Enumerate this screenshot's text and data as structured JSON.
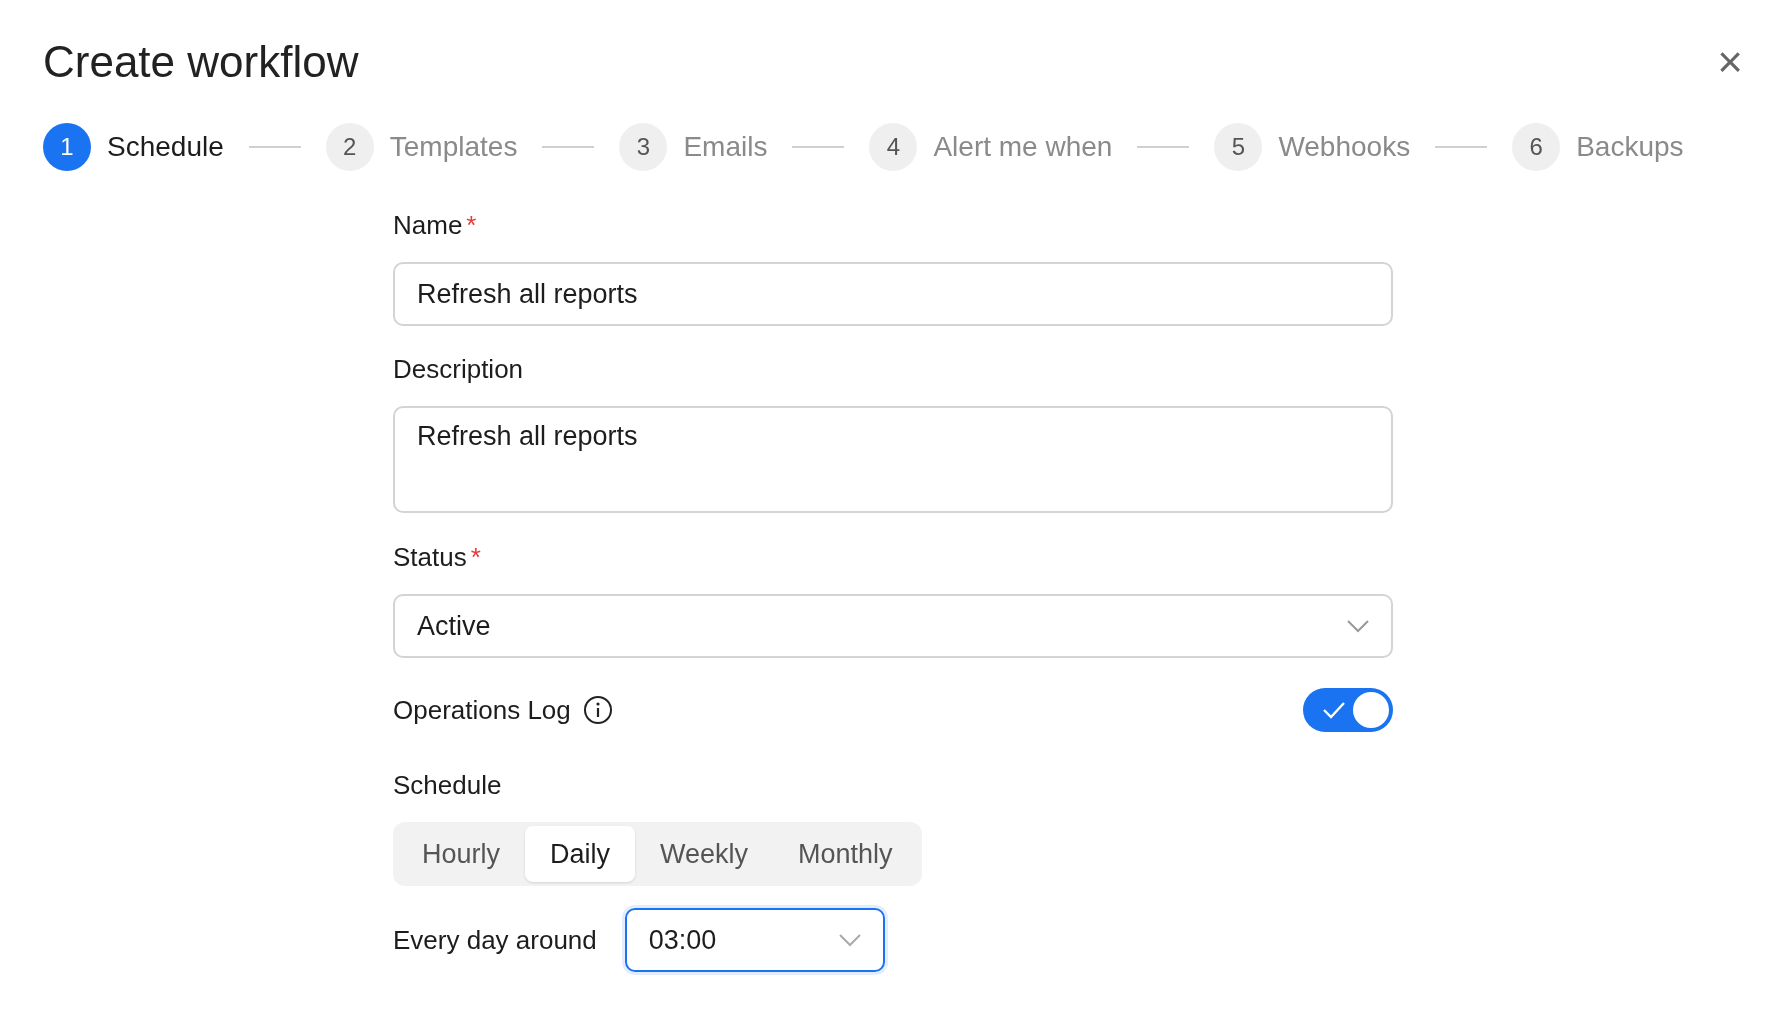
{
  "dialog": {
    "title": "Create workflow",
    "close": "×"
  },
  "steps": [
    {
      "number": "1",
      "label": "Schedule",
      "selected": true
    },
    {
      "number": "2",
      "label": "Templates",
      "selected": false
    },
    {
      "number": "3",
      "label": "Emails",
      "selected": false
    },
    {
      "number": "4",
      "label": "Alert me when",
      "selected": false
    },
    {
      "number": "5",
      "label": "Webhooks",
      "selected": false
    },
    {
      "number": "6",
      "label": "Backups",
      "selected": false
    }
  ],
  "form": {
    "name": {
      "label": "Name",
      "required_mark": "*",
      "value": "Refresh all reports"
    },
    "description": {
      "label": "Description",
      "value": "Refresh all reports"
    },
    "status": {
      "label": "Status",
      "required_mark": "*",
      "value": "Active"
    },
    "operations_log": {
      "label": "Operations Log",
      "on": true
    },
    "schedule": {
      "label": "Schedule",
      "options": [
        {
          "label": "Hourly",
          "selected": false
        },
        {
          "label": "Daily",
          "selected": true
        },
        {
          "label": "Weekly",
          "selected": false
        },
        {
          "label": "Monthly",
          "selected": false
        }
      ],
      "time_label": "Every day around",
      "time_value": "03:00"
    }
  }
}
